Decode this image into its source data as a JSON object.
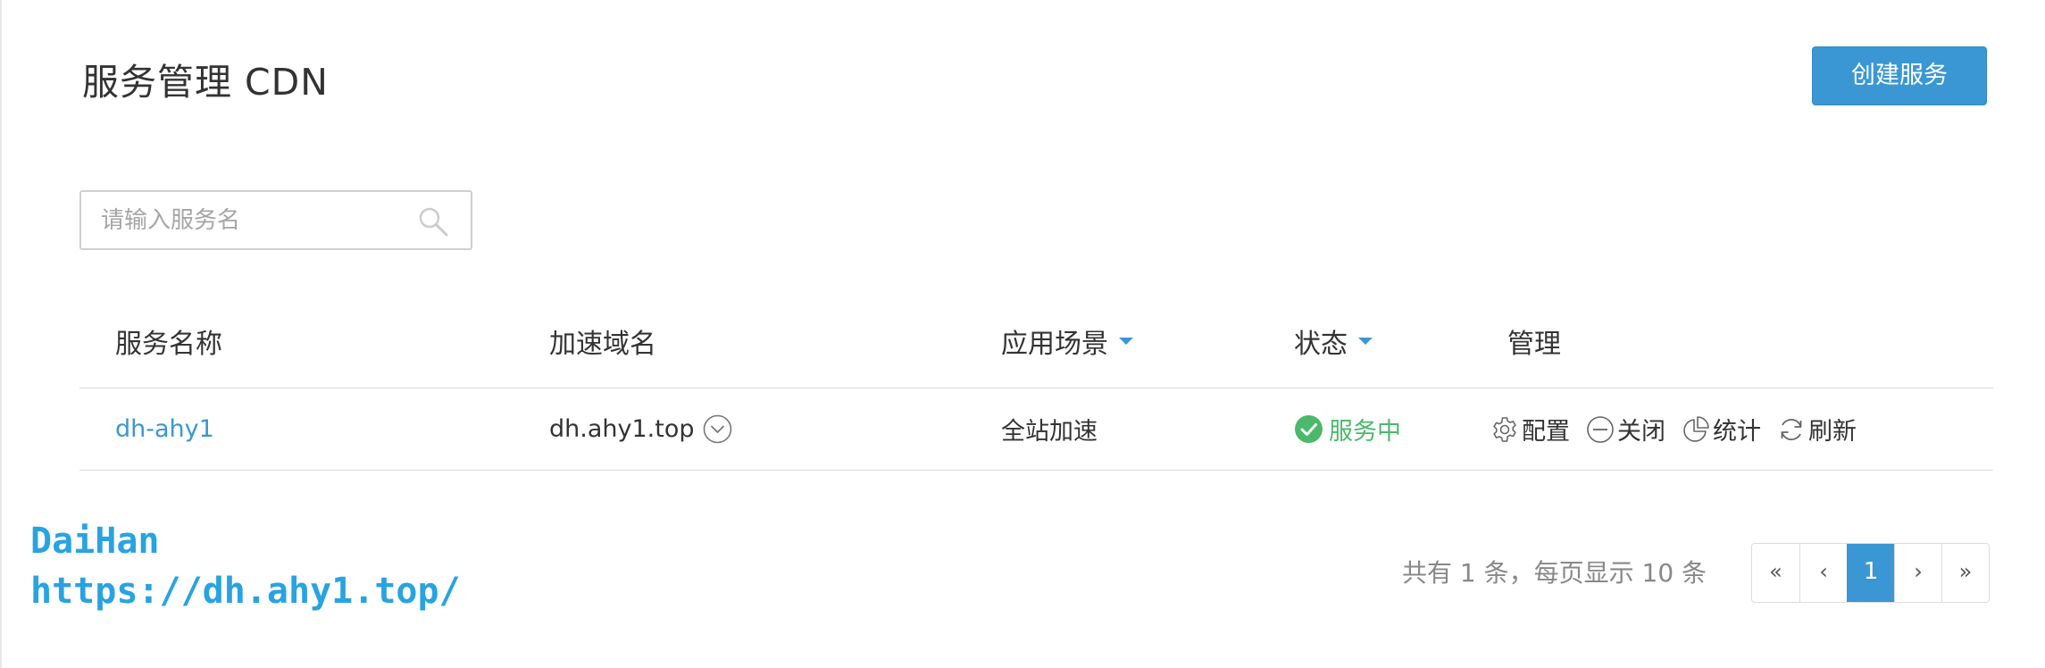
{
  "page": {
    "title": "服务管理 CDN",
    "create_button": "创建服务",
    "accent_color": "#3a97d4",
    "status_ok_color": "#4cb86c"
  },
  "search": {
    "placeholder": "请输入服务名",
    "value": "",
    "icon": "search-icon"
  },
  "table": {
    "columns": {
      "name": "服务名称",
      "domain": "加速域名",
      "scene": "应用场景",
      "status": "状态",
      "manage": "管理"
    },
    "rows": [
      {
        "name": "dh-ahy1",
        "domain": "dh.ahy1.top",
        "scene": "全站加速",
        "status": "服务中",
        "actions": {
          "config": "配置",
          "close": "关闭",
          "stats": "统计",
          "refresh": "刷新"
        }
      }
    ]
  },
  "pagination": {
    "info": "共有 1 条，每页显示 10 条",
    "first": "«",
    "prev": "‹",
    "current": "1",
    "next": "›",
    "last": "»"
  },
  "watermark": {
    "line1": "DaiHan",
    "line2": "https://dh.ahy1.top/"
  }
}
